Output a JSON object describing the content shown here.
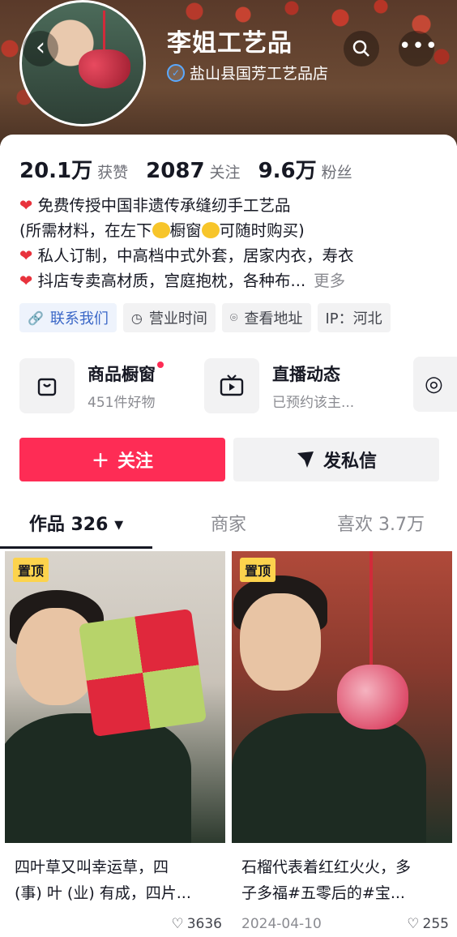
{
  "header": {
    "shop_name": "李姐工艺品",
    "subtitle": "盐山县国芳工艺品店",
    "back_icon": "chevron-left-icon",
    "search_icon": "search-icon",
    "more_icon": "more-horizontal-icon"
  },
  "stats": [
    {
      "value": "20.1万",
      "label": "获赞"
    },
    {
      "value": "2087",
      "label": "关注"
    },
    {
      "value": "9.6万",
      "label": "粉丝"
    }
  ],
  "bio": {
    "line1": "免费传授中国非遗传承缝纫手工艺品",
    "line2_a": "(所需材料，在左下",
    "line2_b": "橱窗",
    "line2_c": "可随时购买)",
    "line3": "私人订制，中高档中式外套，居家内衣，寿衣",
    "line4": "抖店专卖高材质，宫庭抱枕，各种布...",
    "more": "更多"
  },
  "tags": [
    {
      "label": "联系我们",
      "icon": "link-icon"
    },
    {
      "label": "营业时间",
      "icon": "clock-icon"
    },
    {
      "label": "查看地址",
      "icon": "location-pin-icon"
    },
    {
      "label": "IP：河北"
    }
  ],
  "features": [
    {
      "title": "商品橱窗",
      "subtitle": "451件好物",
      "icon": "shopping-bag-icon"
    },
    {
      "title": "直播动态",
      "subtitle": "已预约该主...",
      "icon": "tv-icon"
    }
  ],
  "actions": {
    "follow": "关注",
    "message": "发私信"
  },
  "tabs": [
    {
      "label": "作品 326 ▾"
    },
    {
      "label": "商家"
    },
    {
      "label": "喜欢 3.7万"
    }
  ],
  "posts": [
    {
      "pin": "置顶",
      "caption_l1": "四叶草又叫幸运草，四",
      "caption_l2": "(事) 叶 (业) 有成，四片...",
      "date": "",
      "likes": "3636"
    },
    {
      "pin": "置顶",
      "caption_l1": "石榴代表着红红火火，多",
      "caption_l2": "子多福#五零后的#宝...",
      "date": "2024-04-10",
      "likes": "255"
    }
  ],
  "colors": {
    "accent": "#fe2c55",
    "text": "#161823",
    "muted": "#8a8b91",
    "pin": "#fcd34d"
  }
}
